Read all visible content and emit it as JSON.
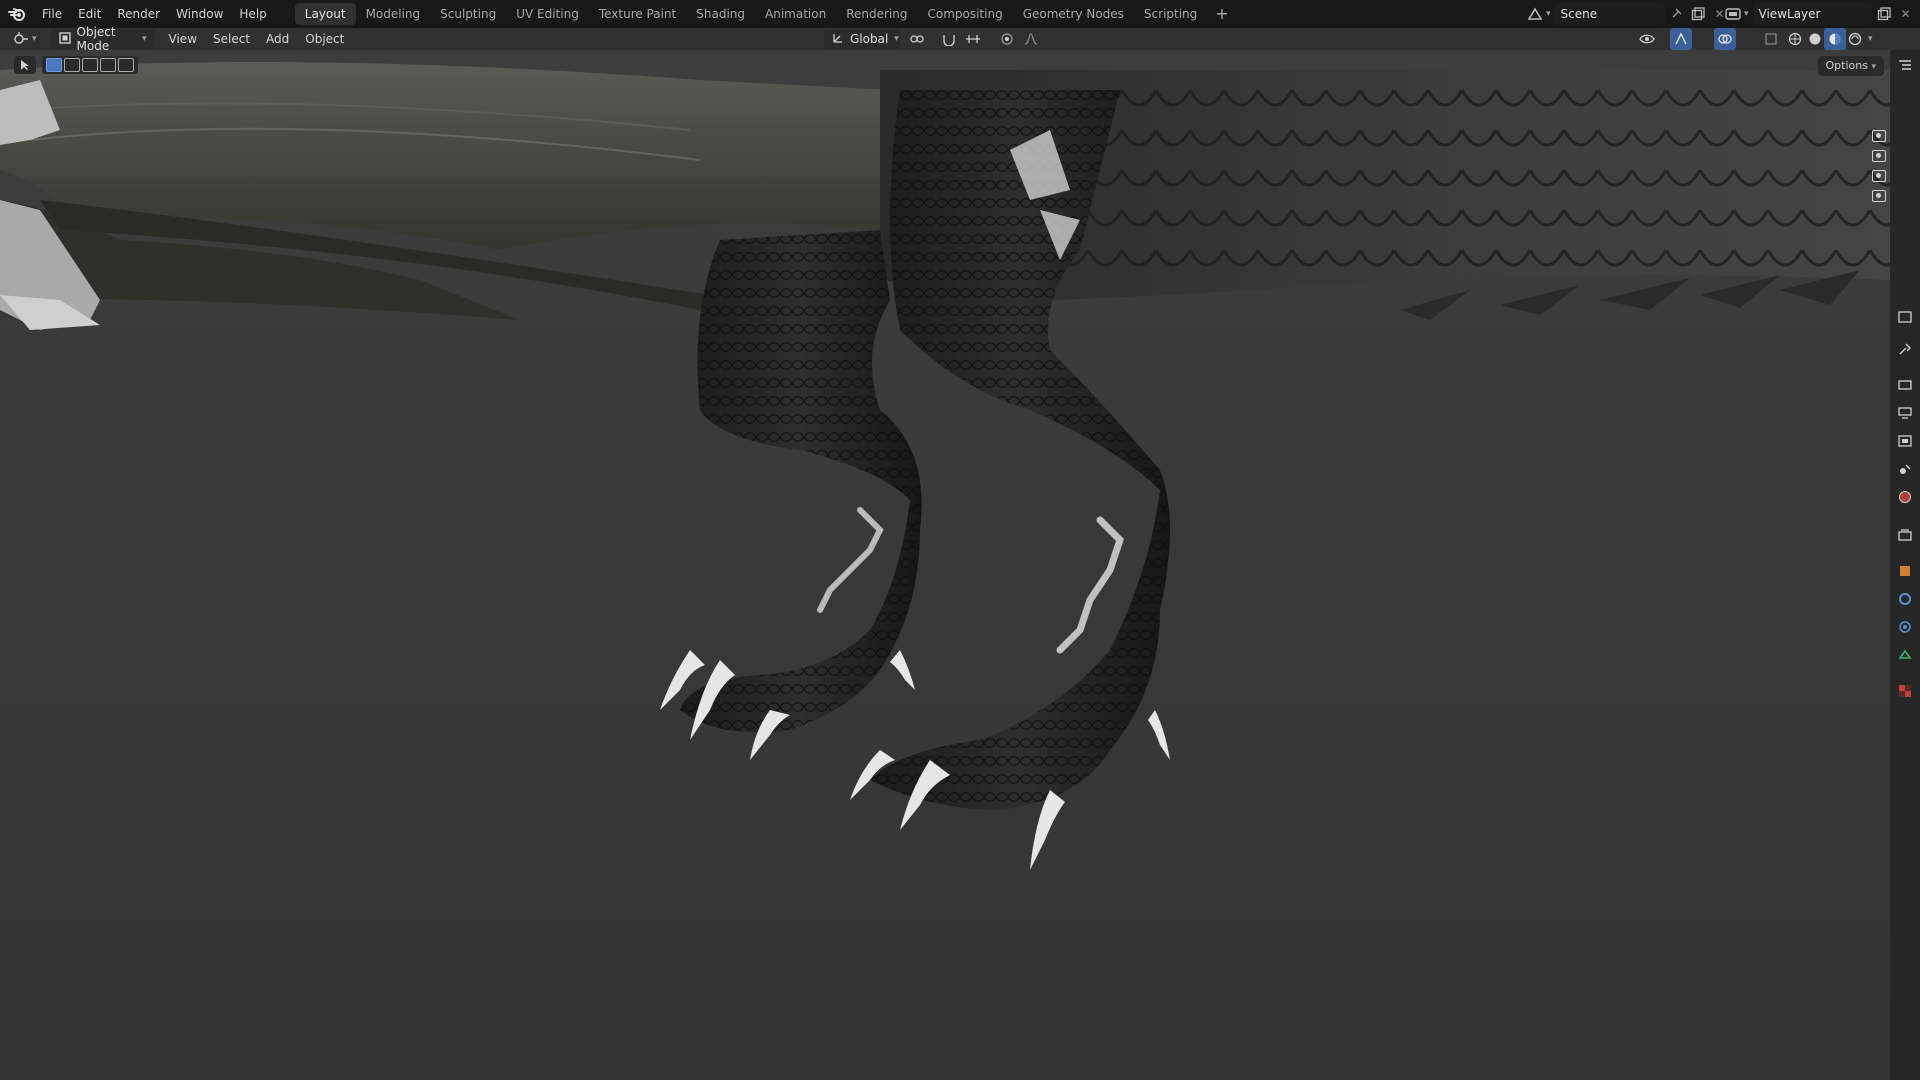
{
  "top_menu": [
    "File",
    "Edit",
    "Render",
    "Window",
    "Help"
  ],
  "workspace_tabs": [
    {
      "label": "Layout",
      "active": true
    },
    {
      "label": "Modeling",
      "active": false
    },
    {
      "label": "Sculpting",
      "active": false
    },
    {
      "label": "UV Editing",
      "active": false
    },
    {
      "label": "Texture Paint",
      "active": false
    },
    {
      "label": "Shading",
      "active": false
    },
    {
      "label": "Animation",
      "active": false
    },
    {
      "label": "Rendering",
      "active": false
    },
    {
      "label": "Compositing",
      "active": false
    },
    {
      "label": "Geometry Nodes",
      "active": false
    },
    {
      "label": "Scripting",
      "active": false
    }
  ],
  "workspace_add": "+",
  "scene": {
    "label": "Scene"
  },
  "view_layer": {
    "label": "ViewLayer"
  },
  "header": {
    "mode": "Object Mode",
    "menus": [
      "View",
      "Select",
      "Add",
      "Object"
    ],
    "transform_orientation": "Global"
  },
  "viewport": {
    "options_label": "Options",
    "subject": "dragon-legs-3d-model"
  },
  "icons": {
    "blender_logo": "blender-logo-icon",
    "editor_type": "editor-type-icon",
    "camera": "camera-icon"
  },
  "colors": {
    "topbar_bg": "#181818",
    "header_bg": "#303030",
    "viewport_bg": "#393939",
    "accent_blue": "#4a78c0",
    "properties_strip_bg": "#262626"
  }
}
